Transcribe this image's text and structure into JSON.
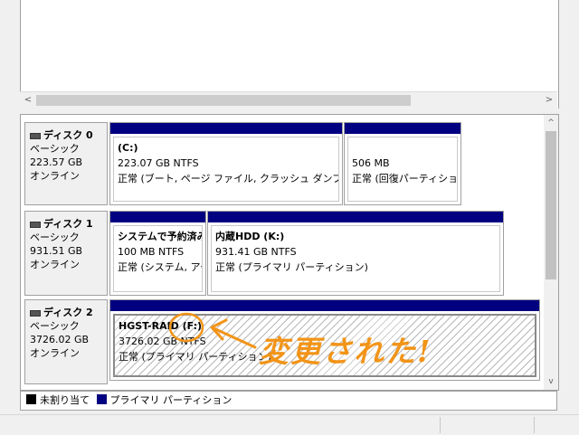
{
  "scrollbar": {
    "left_arrow": "<",
    "right_arrow": ">",
    "up_arrow": "^",
    "down_arrow": "v"
  },
  "disks": [
    {
      "title": "ディスク 0",
      "type": "ベーシック",
      "size": "223.57 GB",
      "status": "オンライン",
      "partitions": [
        {
          "name": "(C:)",
          "size": "223.07 GB NTFS",
          "status": "正常 (ブート, ページ ファイル, クラッシュ ダンプ, プライマ"
        },
        {
          "name": "",
          "size": "506 MB",
          "status": "正常 (回復パーティション"
        }
      ]
    },
    {
      "title": "ディスク 1",
      "type": "ベーシック",
      "size": "931.51 GB",
      "status": "オンライン",
      "partitions": [
        {
          "name": "システムで予約済み",
          "size": "100 MB NTFS",
          "status": "正常 (システム, アク"
        },
        {
          "name": "内蔵HDD (K:)",
          "size": "931.41 GB NTFS",
          "status": "正常 (プライマリ パーティション)"
        }
      ]
    },
    {
      "title": "ディスク 2",
      "type": "ベーシック",
      "size": "3726.02 GB",
      "status": "オンライン",
      "partitions": [
        {
          "name": "HGST-RAID (F:)",
          "size": "3726.02 GB NTFS",
          "status": "正常 (プライマリ パーティション)"
        }
      ]
    }
  ],
  "legend": {
    "unallocated": "未割り当て",
    "primary": "プライマリ パーティション"
  },
  "annotation": "変更された!",
  "colors": {
    "partition_bar": "#000080",
    "unallocated": "#000000",
    "annotation": "#f29418"
  }
}
